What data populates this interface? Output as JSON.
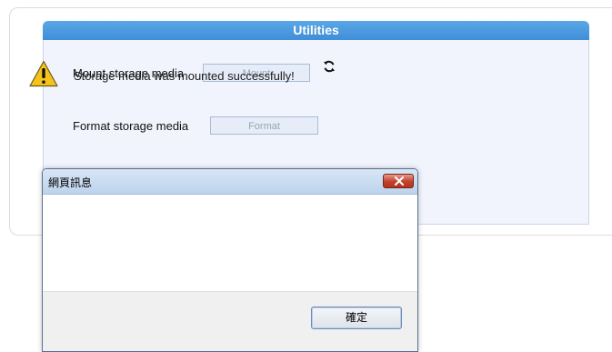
{
  "panel": {
    "title": "Utilities",
    "mount": {
      "label": "Mount storage media",
      "button": "Mount"
    },
    "format": {
      "label": "Format storage media",
      "button": "Format"
    },
    "icons": {
      "refresh": "refresh-icon"
    }
  },
  "dialog": {
    "title": "網頁訊息",
    "message": "Storage media was mounted successfully!",
    "ok_button": "確定",
    "icons": {
      "close": "close-icon",
      "warning": "warning-icon"
    },
    "colors": {
      "close_button": "#c2402b"
    }
  },
  "colors": {
    "header": "#4a9be0",
    "panel_bg": "#f1f4fd"
  }
}
